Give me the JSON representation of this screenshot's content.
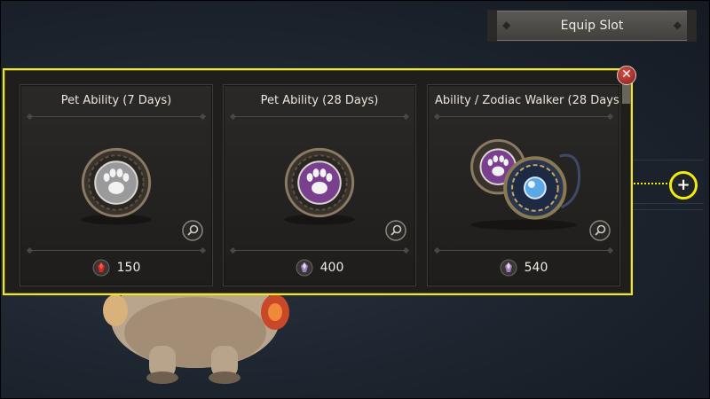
{
  "equip_slot": {
    "label": "Equip Slot"
  },
  "cards": [
    {
      "title": "Pet Ability (7 Days)",
      "price": "150",
      "currency": "red-gem-icon",
      "medal_color": "#9a9a9c"
    },
    {
      "title": "Pet Ability (28 Days)",
      "price": "400",
      "currency": "purple-gem-icon",
      "medal_color": "#7a3f8f"
    },
    {
      "title": "Ability / Zodiac Walker (28 Days",
      "price": "540",
      "currency": "purple-gem-icon",
      "medal_color": "#7a3f8f"
    }
  ],
  "icons": {
    "close": "close-icon",
    "zoom": "magnifier-icon",
    "add": "plus-icon",
    "paw": "paw-icon"
  },
  "colors": {
    "highlight": "#f2ea10",
    "close": "#b5332e",
    "panel": "#1f1e1c"
  }
}
